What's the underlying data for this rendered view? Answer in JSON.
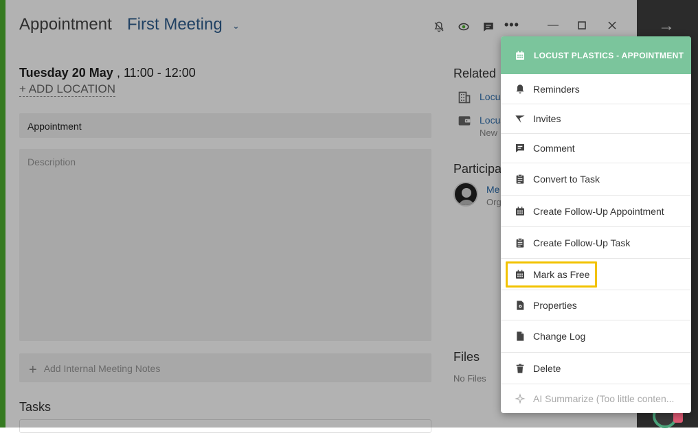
{
  "header": {
    "title": "Appointment",
    "subject": "First Meeting"
  },
  "schedule": {
    "day": "Tuesday 20 May",
    "time": ", 11:00 - 12:00",
    "add_location": "+ ADD LOCATION"
  },
  "form": {
    "type_value": "Appointment",
    "description_placeholder": "Description",
    "notes_label": "Add Internal Meeting Notes",
    "tasks_heading": "Tasks"
  },
  "related": {
    "heading": "Related",
    "items": [
      {
        "label": "Locus",
        "sub": ""
      },
      {
        "label": "Locus",
        "sub": "New"
      }
    ]
  },
  "participants": {
    "heading": "Participa",
    "name": "Me",
    "role": "Org"
  },
  "files": {
    "heading": "Files",
    "empty": "No Files"
  },
  "menu": {
    "header": "LOCUST PLASTICS - APPOINTMENT",
    "items": [
      {
        "label": "Reminders",
        "icon": "bell-icon"
      },
      {
        "label": "Invites",
        "icon": "send-icon"
      },
      {
        "label": "Comment",
        "icon": "comment-icon"
      },
      {
        "label": "Convert to Task",
        "icon": "clipboard-icon"
      },
      {
        "label": "Create Follow-Up Appointment",
        "icon": "calendar-icon"
      },
      {
        "label": "Create Follow-Up Task",
        "icon": "clipboard-icon"
      },
      {
        "label": "Mark as Free",
        "icon": "calendar-icon"
      },
      {
        "label": "Properties",
        "icon": "properties-icon"
      },
      {
        "label": "Change Log",
        "icon": "document-icon"
      },
      {
        "label": "Delete",
        "icon": "trash-icon"
      },
      {
        "label": "AI Summarize (Too little conten...",
        "icon": "sparkle-icon"
      }
    ],
    "highlighted_item": "Mark as Free"
  },
  "colors": {
    "accent": "#4caf2f",
    "menu_header": "#7bc59c",
    "link": "#2f5e8e",
    "highlight": "#f2c200"
  }
}
